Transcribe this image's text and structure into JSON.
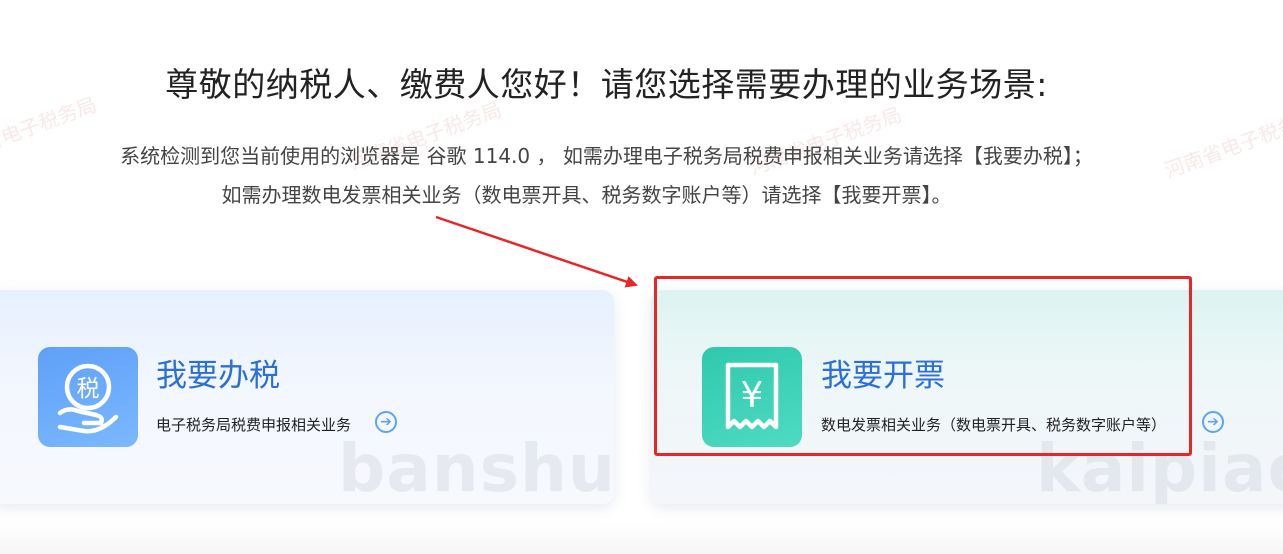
{
  "heading": "尊敬的纳税人、缴费人您好！请您选择需要办理的业务场景:",
  "notice": {
    "line1": "系统检测到您当前使用的浏览器是 谷歌 114.0 ， 如需办理电子税务局税费申报相关业务请选择【我要办税】；",
    "line2": "如需办理数电发票相关业务（数电票开具、税务数字账户等）请选择【我要开票】。"
  },
  "cards": {
    "tax": {
      "title": "我要办税",
      "description": "电子税务局税费申报相关业务",
      "icon_glyph": "税",
      "background_word": "banshui",
      "icon": "tax-hand-icon"
    },
    "invoice": {
      "title": "我要开票",
      "description": "数电发票相关业务（数电票开具、税务数字账户等）",
      "icon_glyph": "¥",
      "background_word": "kaipiao",
      "icon": "receipt-yen-icon"
    }
  },
  "watermark_text": "河南省电子税务局",
  "colors": {
    "title_blue": "#2e6fd6",
    "tax_icon": "#5fa0f7",
    "invoice_icon": "#2fc9ad",
    "annotation_red": "#e8262a"
  }
}
